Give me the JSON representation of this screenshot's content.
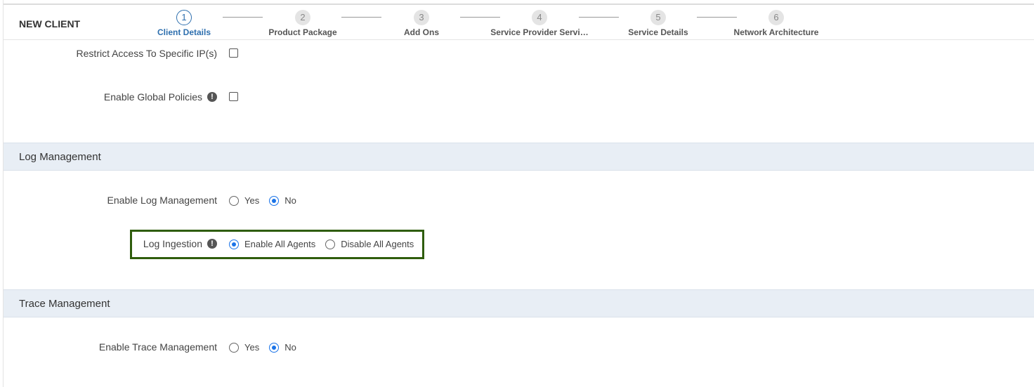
{
  "header": {
    "title": "NEW CLIENT",
    "steps": [
      {
        "number": "1",
        "label": "Client Details",
        "active": true
      },
      {
        "number": "2",
        "label": "Product Package",
        "active": false
      },
      {
        "number": "3",
        "label": "Add Ons",
        "active": false
      },
      {
        "number": "4",
        "label": "Service Provider Servi…",
        "active": false
      },
      {
        "number": "5",
        "label": "Service Details",
        "active": false
      },
      {
        "number": "6",
        "label": "Network Architecture",
        "active": false
      }
    ]
  },
  "access": {
    "restrict_ip_label": "Restrict Access To Specific IP(s)",
    "restrict_ip_checked": false,
    "global_policies_label": "Enable Global Policies",
    "global_policies_checked": false
  },
  "log_management": {
    "section_title": "Log Management",
    "enable_label": "Enable Log Management",
    "enable_options": [
      "Yes",
      "No"
    ],
    "enable_selected": "No",
    "ingestion_label": "Log Ingestion",
    "ingestion_options": [
      "Enable All Agents",
      "Disable All Agents"
    ],
    "ingestion_selected": "Enable All Agents"
  },
  "trace_management": {
    "section_title": "Trace Management",
    "enable_label": "Enable Trace Management",
    "enable_options": [
      "Yes",
      "No"
    ],
    "enable_selected": "No"
  },
  "colors": {
    "accent": "#2e6fae",
    "radio_selected": "#1a73e8",
    "section_bg": "#e8eef5",
    "highlight_border": "#2f5d0c"
  },
  "icons": {
    "info": "info-circle-icon"
  }
}
